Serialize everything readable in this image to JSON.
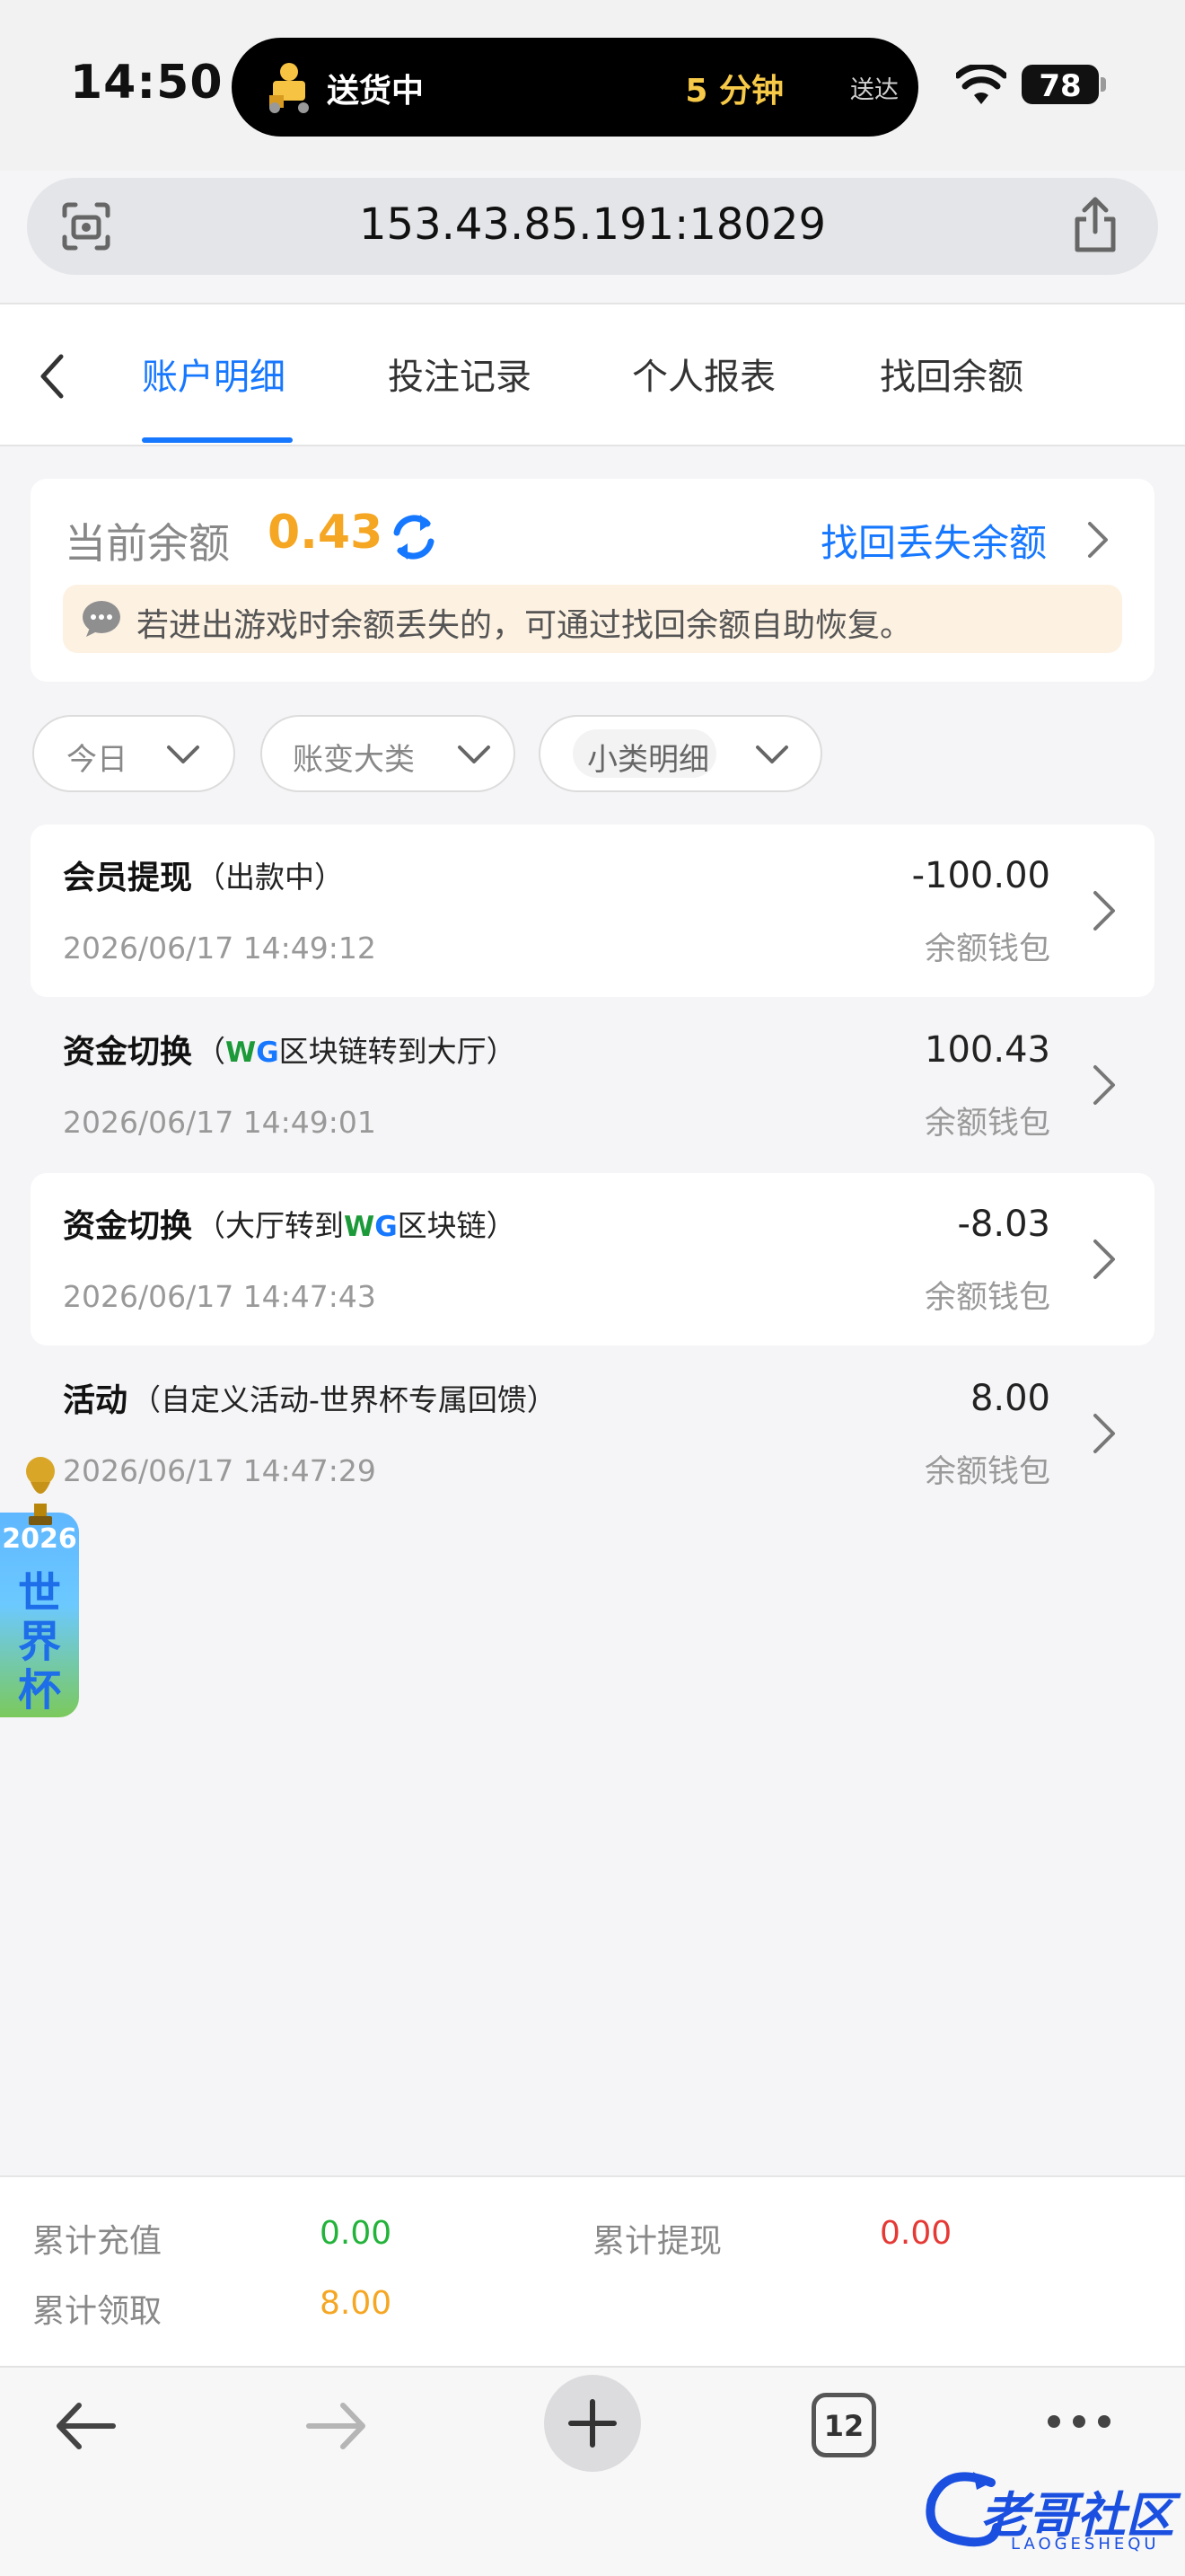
{
  "status": {
    "time": "14:50",
    "activity": "送货中",
    "eta": "5 分钟",
    "eta_suffix": "送达",
    "battery": "78"
  },
  "browser": {
    "url": "153.43.85.191:18029",
    "open_tabs": "12"
  },
  "tabs": [
    "账户明细",
    "投注记录",
    "个人报表",
    "找回余额"
  ],
  "balance": {
    "label": "当前余额",
    "value": "0.43",
    "recover_link": "找回丢失余额",
    "notice": "若进出游戏时余额丢失的，可通过找回余额自助恢复。"
  },
  "filters": {
    "period": "今日",
    "category": "账变大类",
    "subcategory": "小类明细"
  },
  "records": [
    {
      "title": "会员提现",
      "detail": "（出款中）",
      "time": "2026/06/17 14:49:12",
      "amount": "-100.00",
      "wallet": "余额钱包"
    },
    {
      "title": "资金切换",
      "detail_prefix": "（",
      "detail_logo": "WG",
      "detail_rest": "区块链转到大厅）",
      "time": "2026/06/17 14:49:01",
      "amount": "100.43",
      "wallet": "余额钱包"
    },
    {
      "title": "资金切换",
      "detail_prefix": "（大厅转到",
      "detail_logo": "WG",
      "detail_rest": "区块链）",
      "time": "2026/06/17 14:47:43",
      "amount": "-8.03",
      "wallet": "余额钱包"
    },
    {
      "title": "活动",
      "detail": "（自定义活动-世界杯专属回馈）",
      "time": "2026/06/17 14:47:29",
      "amount": "8.00",
      "wallet": "余额钱包"
    }
  ],
  "promo": {
    "year": "2026",
    "chars": [
      "世",
      "界",
      "杯"
    ]
  },
  "summary": {
    "recharge_label": "累计充值",
    "recharge_value": "0.00",
    "withdraw_label": "累计提现",
    "withdraw_value": "0.00",
    "claim_label": "累计领取",
    "claim_value": "8.00"
  },
  "watermark": {
    "text": "老哥社区",
    "sub": "LAOGESHEQU"
  },
  "colors": {
    "accent": "#1677ff",
    "balance": "#f5a623",
    "green": "#22b33a",
    "red": "#e53935"
  }
}
